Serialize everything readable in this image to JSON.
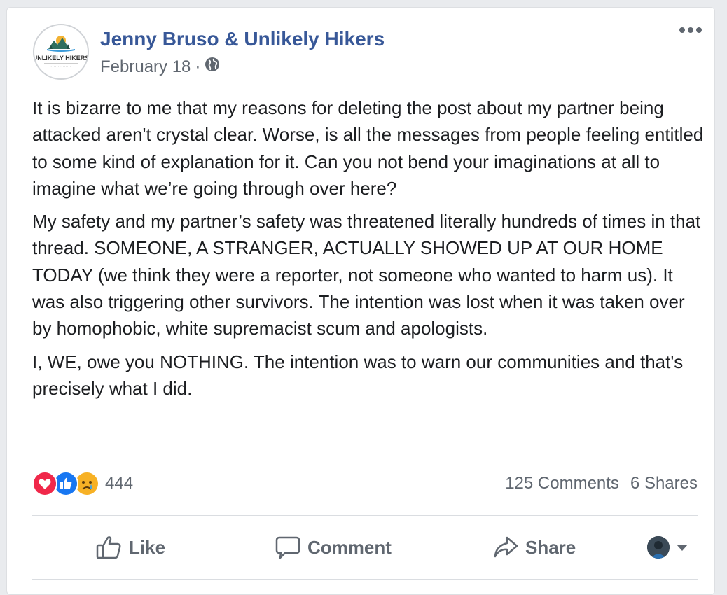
{
  "post": {
    "author": "Jenny Bruso & Unlikely Hikers",
    "date": "February 18",
    "separator": "·",
    "privacy_icon": "globe-icon",
    "avatar_text": "UNLIKELY HIKERS",
    "paragraphs": [
      "It is bizarre to me that my reasons for deleting the post about my partner being attacked aren't crystal clear. Worse, is all the messages from people feeling entitled to some kind of explanation for it. Can you not bend your imaginations at all to imagine what we’re going through over here?",
      "My safety and my partner’s safety was threatened literally hundreds of times in that thread. SOMEONE, A STRANGER, ACTUALLY SHOWED UP AT OUR HOME TODAY (we think they were a reporter, not someone who wanted to harm us). It was also triggering other survivors. The intention was lost when it was taken over by homophobic, white supremacist scum and apologists.",
      "I, WE, owe you NOTHING. The intention was to warn our communities and that's precisely what I did."
    ]
  },
  "stats": {
    "reactions": [
      "love",
      "like",
      "sad"
    ],
    "reaction_count": "444",
    "comments": "125 Comments",
    "shares": "6 Shares"
  },
  "actions": {
    "like": "Like",
    "comment": "Comment",
    "share": "Share"
  },
  "colors": {
    "author": "#385898",
    "muted": "#606770",
    "text": "#1c1e21",
    "love": "#f0284a",
    "like": "#1877f2",
    "sad": "#f7b125"
  }
}
